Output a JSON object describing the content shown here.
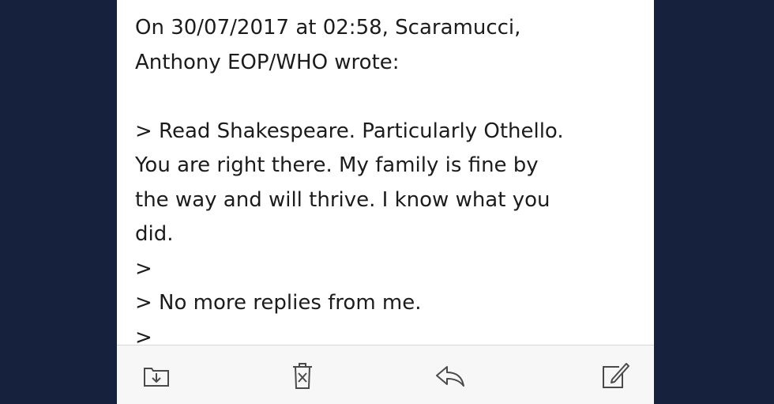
{
  "email": {
    "lines": [
      "On 30/07/2017 at 02:58, Scaramucci,",
      "Anthony EOP/WHO wrote:",
      "",
      "> Read Shakespeare. Particularly Othello.",
      "You are right there. My family is fine by",
      "the way and will thrive. I know what you",
      "did.",
      ">",
      "> No more replies from me.",
      ">"
    ]
  },
  "toolbar": {
    "icons": [
      "move-to-folder-icon",
      "trash-icon",
      "reply-icon",
      "compose-icon"
    ],
    "icon_color": "#4a4a4a"
  },
  "colors": {
    "background": "#16213d",
    "panel": "#ffffff",
    "text": "#1c1c1c",
    "toolbar": "#f7f7f7"
  }
}
